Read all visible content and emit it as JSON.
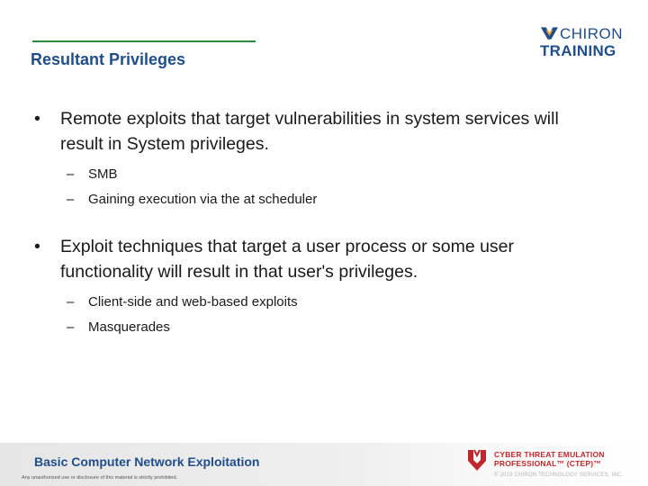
{
  "header": {
    "title": "Resultant Privileges",
    "logo": {
      "line1": "CHIRON",
      "line2": "TRAINING",
      "color": "#1f4e8a"
    },
    "accent_rule_color": "#2e8b3a"
  },
  "bullets": [
    {
      "marker": "•",
      "text": "Remote exploits that target vulnerabilities in system services will result in System privileges.",
      "subitems": [
        {
          "marker": "–",
          "text": "SMB"
        },
        {
          "marker": "–",
          "text": "Gaining execution via the at scheduler"
        }
      ]
    },
    {
      "marker": "•",
      "text": "Exploit techniques that target a user process or some user functionality will result in that user's privileges.",
      "subitems": [
        {
          "marker": "–",
          "text": "Client-side and web-based exploits"
        },
        {
          "marker": "–",
          "text": "Masquerades"
        }
      ]
    }
  ],
  "footer": {
    "course_title": "Basic Computer Network Exploitation",
    "disclaimer": "Any unauthorized use or disclosure of this material is strictly prohibited.",
    "ctep_line1": "CYBER THREAT EMULATION",
    "ctep_line2": "PROFESSIONAL™ (CTEP)™",
    "copyright": "© 2019 CHIRON TECHNOLOGY SERVICES, INC.",
    "ctep_color": "#c0272d"
  }
}
